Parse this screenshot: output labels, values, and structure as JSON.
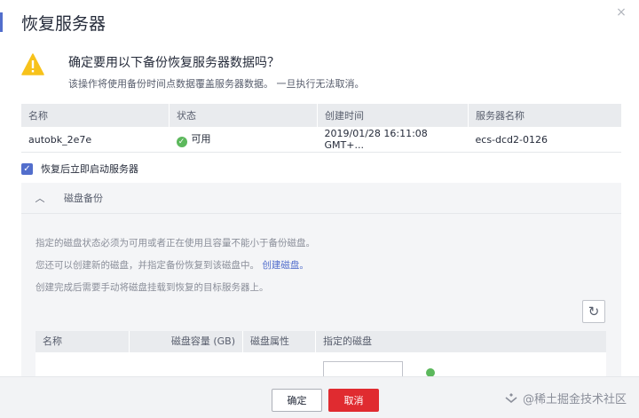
{
  "dialog": {
    "title": "恢复服务器",
    "close_glyph": "×"
  },
  "confirm": {
    "question": "确定要用以下备份恢复服务器数据吗？",
    "description": "该操作将使用备份时间点数据覆盖服务器数据。 一旦执行无法取消。"
  },
  "backup_table": {
    "headers": [
      "名称",
      "状态",
      "创建时间",
      "服务器名称"
    ],
    "rows": [
      {
        "name": "autobk_2e7e",
        "status": "可用",
        "created": "2019/01/28 16:11:08 GMT+...",
        "server": "ecs-dcd2-0126"
      }
    ]
  },
  "start_after_restore": {
    "label": "恢复后立即启动服务器",
    "checked": true
  },
  "disk_backup": {
    "section_title": "磁盘备份",
    "note1": "指定的磁盘状态必须为可用或者正在使用且容量不能小于备份磁盘。",
    "note2_prefix": "您还可以创建新的磁盘，并指定备份恢复到该磁盘中。",
    "note2_link": "创建磁盘。",
    "note3": "创建完成后需要手动将磁盘挂载到恢复的目标服务器上。",
    "headers": [
      "名称",
      "磁盘容量 (GB)",
      "磁盘属性",
      "指定的磁盘"
    ]
  },
  "footer": {
    "ok_label": "确定",
    "cancel_label": "取消"
  },
  "watermark": "@稀土掘金技术社区",
  "colors": {
    "accent": "#526ecc",
    "danger": "#e02b30",
    "success": "#5cb85c",
    "warning": "#f7c21b"
  }
}
